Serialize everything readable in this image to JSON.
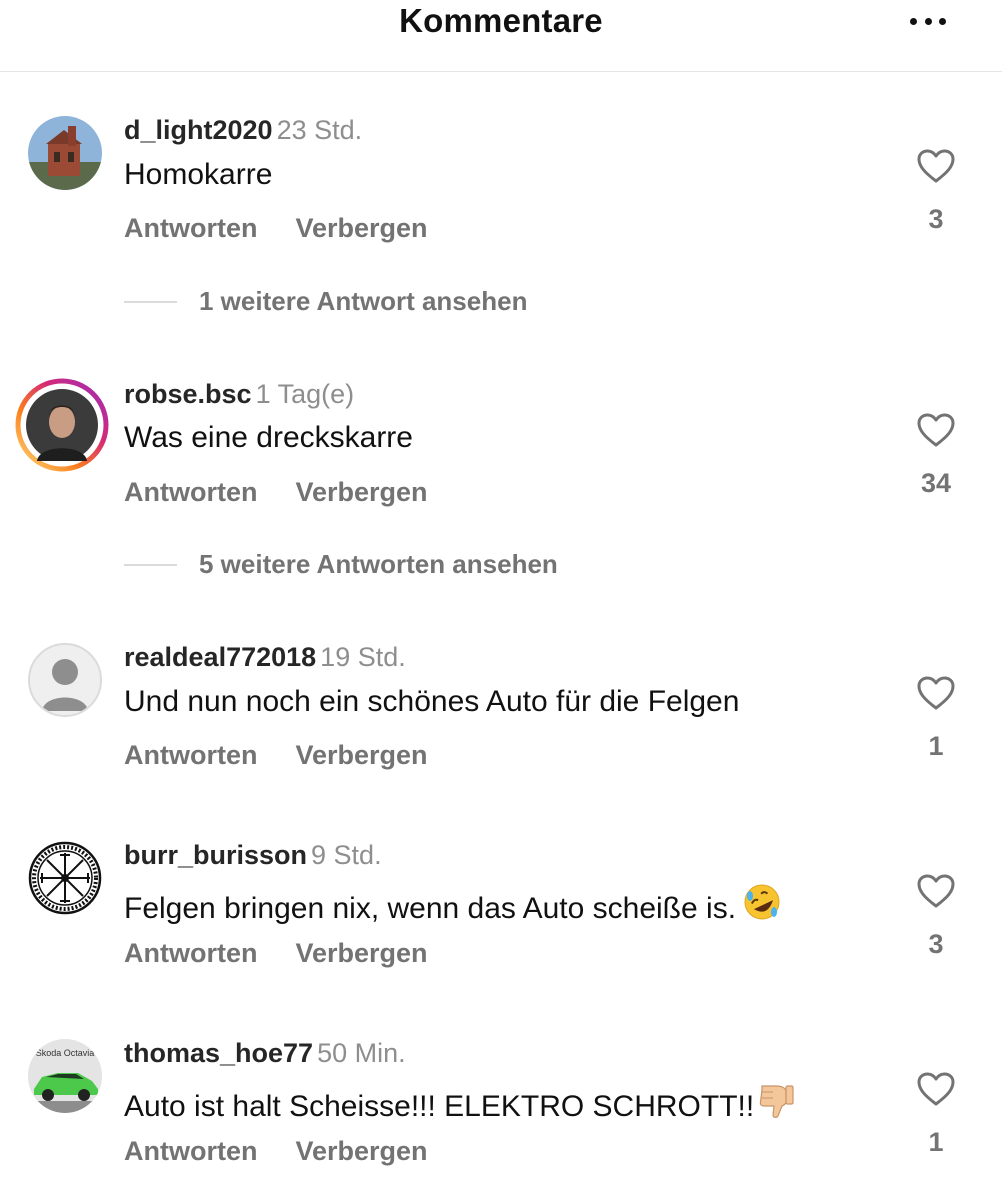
{
  "header": {
    "title": "Kommentare",
    "more_icon": "more-horizontal-icon"
  },
  "labels": {
    "reply": "Antworten",
    "hide": "Verbergen"
  },
  "comments": [
    {
      "author": "d_light2020",
      "time": "23 Std.",
      "text": "Homokarre",
      "likes": "3",
      "more_replies": "1 weitere Antwort ansehen",
      "avatar": "church-photo"
    },
    {
      "author": "robse.bsc",
      "time": "1 Tag(e)",
      "text": "Was eine dreckskarre",
      "likes": "34",
      "more_replies": "5 weitere Antworten ansehen",
      "avatar": "portrait-with-story-ring"
    },
    {
      "author": "realdeal772018",
      "time": "19 Std.",
      "text": "Und nun noch ein schönes Auto für die Felgen",
      "likes": "1",
      "avatar": "default-user-silhouette"
    },
    {
      "author": "burr_burisson",
      "time": "9 Std.",
      "text": "Felgen bringen nix, wenn das Auto scheiße is.",
      "emoji": "rolling-on-floor-laughing-emoji",
      "likes": "3",
      "avatar": "vegvisir-rune-symbol"
    },
    {
      "author": "thomas_hoe77",
      "time": "50 Min.",
      "text": "Auto ist halt Scheisse!!! ELEKTRO SCHROTT!!",
      "emoji": "thumbs-down-emoji",
      "likes": "1",
      "avatar": "green-car-photo",
      "avatar_text": "Skoda Octavia"
    }
  ],
  "colors": {
    "author": "#262626",
    "secondary": "#737373",
    "time": "#8e8e8e",
    "story_ring_start": "#feda75",
    "story_ring_mid": "#d62976",
    "story_ring_end": "#962fbf",
    "car_green": "#4cc94a"
  }
}
